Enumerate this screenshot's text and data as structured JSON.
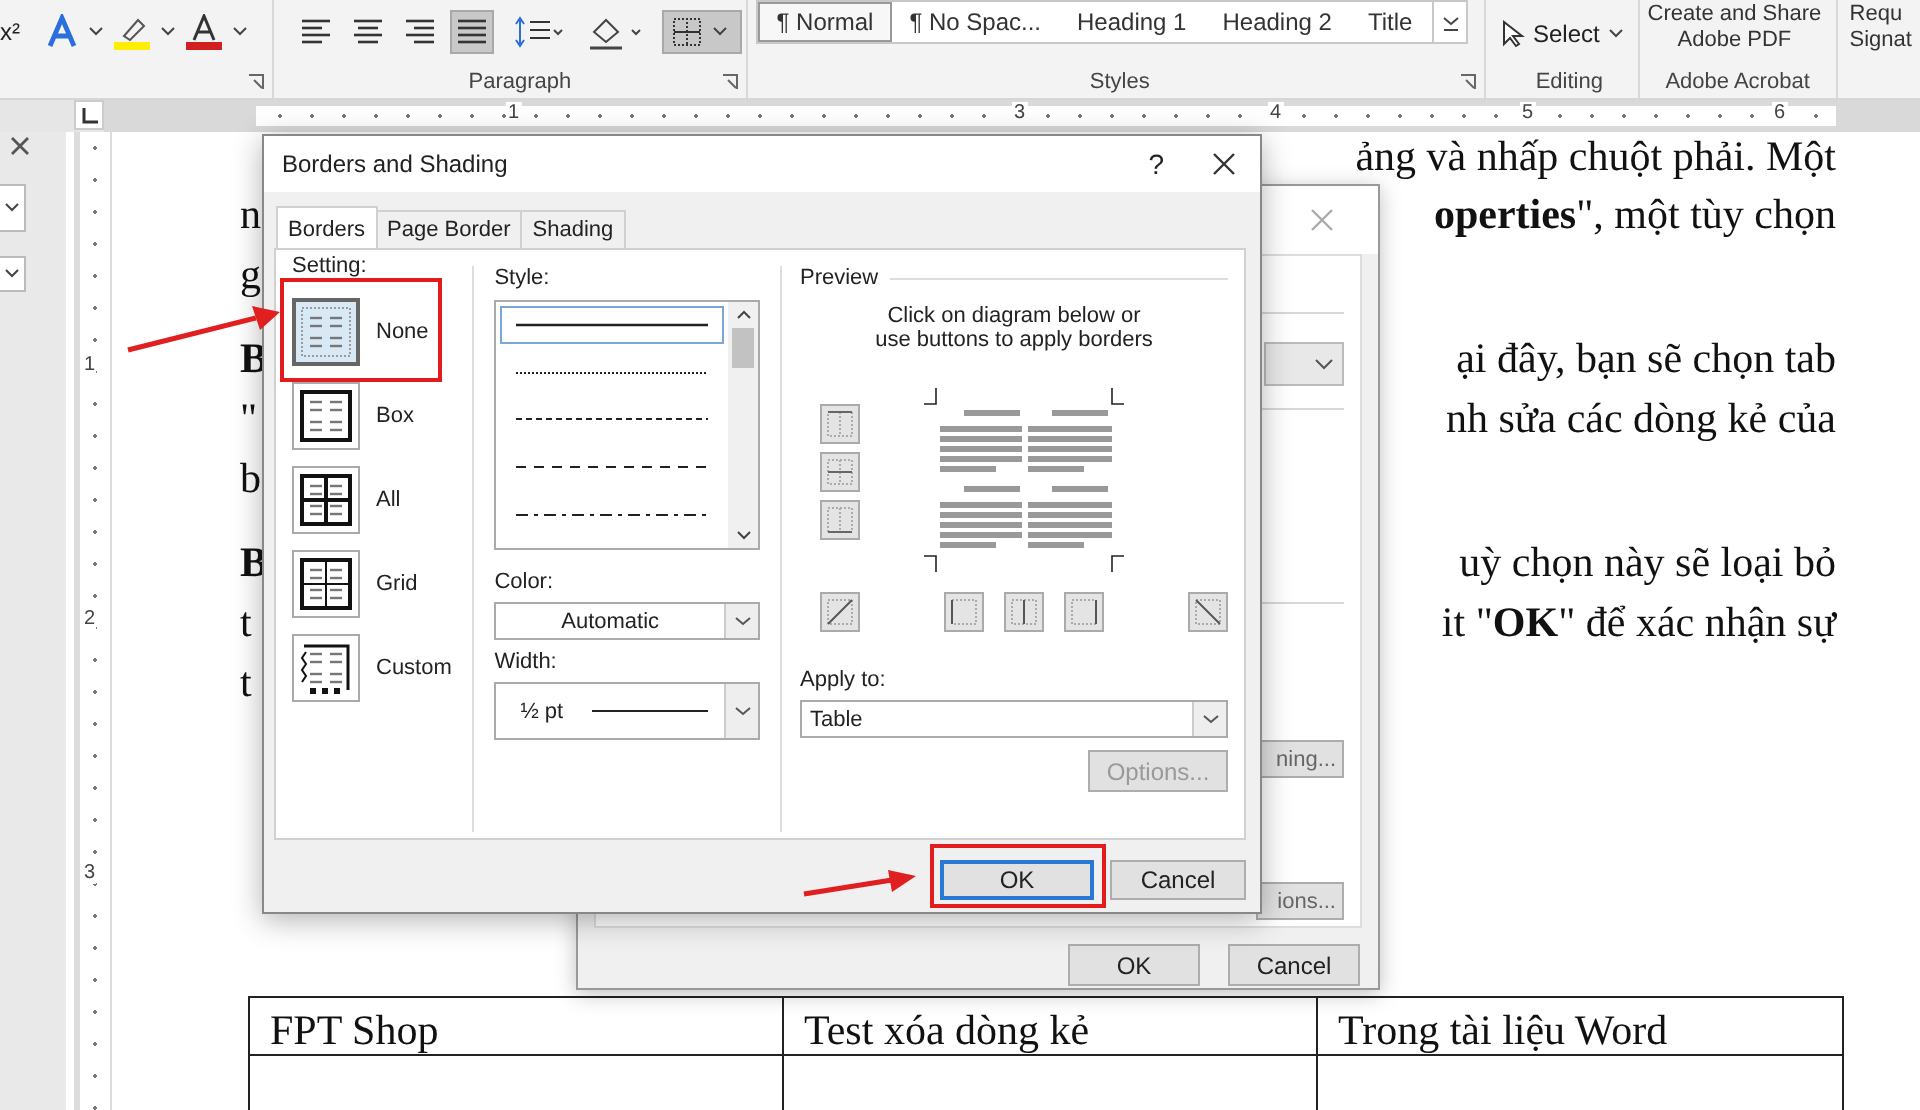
{
  "ribbon": {
    "superscript": "x²",
    "alignment": [
      {
        "selected": false
      },
      {
        "selected": false
      },
      {
        "selected": false
      },
      {
        "selected": true
      }
    ],
    "borders_selected": true,
    "paragraph_label": "Paragraph",
    "styles": [
      {
        "label": "¶ Normal",
        "selected": true
      },
      {
        "label": "¶ No Spac...",
        "selected": false
      },
      {
        "label": "Heading 1",
        "selected": false
      },
      {
        "label": "Heading 2",
        "selected": false
      },
      {
        "label": "Title",
        "selected": false
      }
    ],
    "styles_label": "Styles",
    "select_button": "Select",
    "editing_label": "Editing",
    "acrobat_lines": [
      "Create and Share",
      "Adobe PDF"
    ],
    "acrobat_label": "Adobe Acrobat",
    "cut_lines": [
      "Requ",
      "Signat"
    ]
  },
  "ruler": {
    "numbers": [
      "1",
      "3",
      "4",
      "5",
      "6"
    ],
    "vertical_numbers": [
      "1",
      "2",
      "3"
    ]
  },
  "document": {
    "paragraphs": [
      [
        {
          "right": "ảng và nhấp chuột phải. Một"
        },
        {
          "left": "n",
          "right": "**operties**\", một tùy chọn"
        },
        {
          "left": "g"
        }
      ],
      [
        {
          "left": "**B**",
          "right": "ại đây, bạn sẽ chọn tab"
        },
        {
          "left": "\"",
          "right": "nh sửa các dòng kẻ của"
        },
        {
          "left": "b"
        }
      ],
      [
        {
          "left": "**B**",
          "right": "uỳ chọn này sẽ loại bỏ"
        },
        {
          "left": "t",
          "right": "it \"**OK**\" để xác nhận sự"
        },
        {
          "left": "t"
        }
      ]
    ]
  },
  "table": {
    "rows": [
      [
        "FPT Shop",
        "Test xóa dòng kẻ",
        "Trong tài liệu Word"
      ]
    ]
  },
  "back_dialog": {
    "partial_buttons": [
      "ning...",
      "ions..."
    ],
    "ok": "OK",
    "cancel": "Cancel"
  },
  "dialog": {
    "title": "Borders and Shading",
    "help": "?",
    "tabs": [
      {
        "label": "Borders",
        "selected": true
      },
      {
        "label": "Page Border",
        "selected": false
      },
      {
        "label": "Shading",
        "selected": false
      }
    ],
    "setting_label": "Setting:",
    "settings": [
      {
        "kind": "none",
        "label": "None",
        "selected": true
      },
      {
        "kind": "box",
        "label": "Box",
        "selected": false
      },
      {
        "kind": "all",
        "label": "All",
        "selected": false
      },
      {
        "kind": "grid",
        "label": "Grid",
        "selected": false
      },
      {
        "kind": "custom",
        "label": "Custom",
        "selected": false
      }
    ],
    "style_label": "Style:",
    "line_styles": [
      {
        "kind": "solid",
        "selected": true
      },
      {
        "kind": "dotted",
        "selected": false
      },
      {
        "kind": "dashed",
        "selected": false
      },
      {
        "kind": "long_dash",
        "selected": false
      },
      {
        "kind": "dash_dot",
        "selected": false
      }
    ],
    "color_label": "Color:",
    "color_value": "Automatic",
    "width_label": "Width:",
    "width_value": "½ pt",
    "preview_label": "Preview",
    "preview_hint": [
      "Click on diagram below or",
      "use buttons to apply borders"
    ],
    "apply_label": "Apply to:",
    "apply_value": "Table",
    "options_button": {
      "label": "Options...",
      "disabled": true
    },
    "ok": "OK",
    "cancel": "Cancel"
  }
}
